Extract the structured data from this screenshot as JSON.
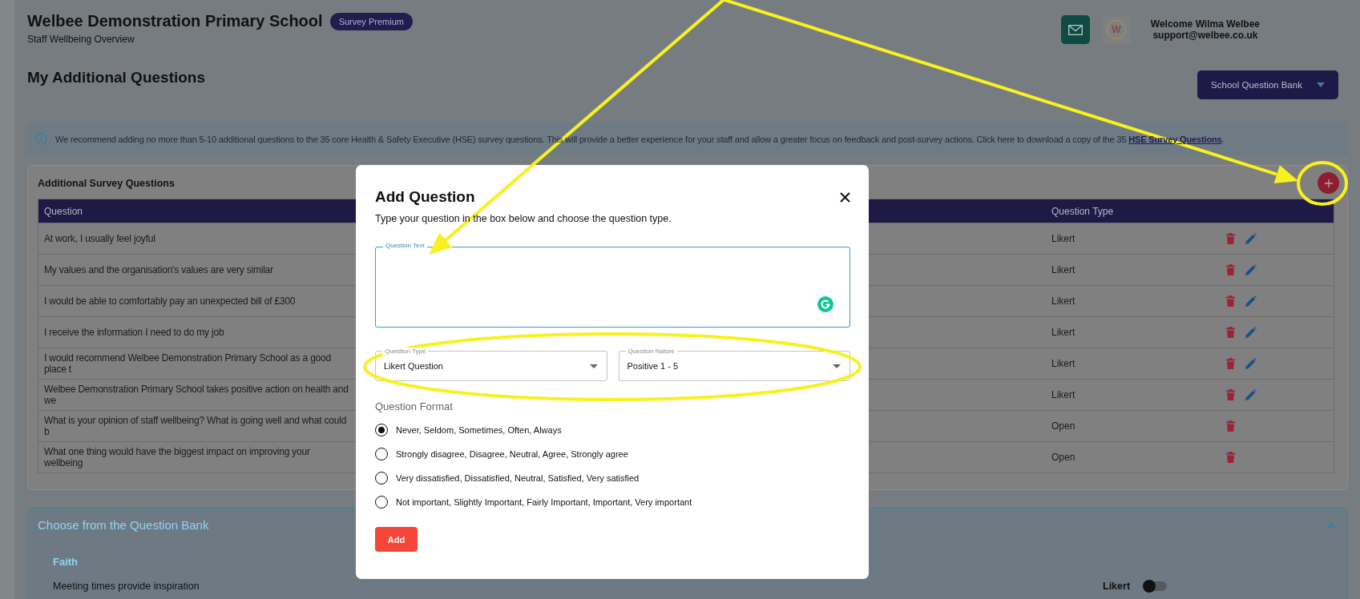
{
  "header": {
    "school": "Welbee Demonstration Primary School",
    "badge": "Survey Premium",
    "subtitle": "Staff Wellbeing Overview",
    "logo_letter": "W",
    "welcome": "Welcome Wilma Welbee",
    "email": "support@welbee.co.uk"
  },
  "page_title": "My Additional Questions",
  "bank_button": {
    "label": "School Question Bank"
  },
  "info": {
    "text": "We recommend adding no more than 5-10 additional questions to the 35 core Health & Safety Executive (HSE) survey questions. This will provide a better experience for your staff and allow a greater focus on feedback and post-survey actions. Click here to download a copy of the 35 ",
    "link": "HSE Survey Questions",
    "end": "."
  },
  "questions_card": {
    "title": "Additional Survey Questions",
    "columns": [
      "Question",
      "Question Type"
    ],
    "rows": [
      {
        "question": "At work, I usually feel joyful",
        "type": "Likert",
        "editable": true
      },
      {
        "question": "My values and the organisation's values are very similar",
        "type": "Likert",
        "editable": true
      },
      {
        "question": "I would be able to comfortably pay an unexpected bill of £300",
        "type": "Likert",
        "editable": true
      },
      {
        "question": "I receive the information I need to do my job",
        "type": "Likert",
        "editable": true
      },
      {
        "question": "I would recommend Welbee Demonstration Primary School as a good place t",
        "type": "Likert",
        "editable": true
      },
      {
        "question": "Welbee Demonstration Primary School takes positive action on health and we",
        "type": "Likert",
        "editable": true
      },
      {
        "question": "What is your opinion of staff wellbeing? What is going well and what could b",
        "type": "Open",
        "editable": false
      },
      {
        "question": "What one thing would have the biggest impact on improving your wellbeing",
        "type": "Open",
        "editable": false
      }
    ]
  },
  "bank_panel": {
    "title": "Choose from the Question Bank",
    "expanded": true,
    "groups": [
      {
        "name": "Faith",
        "items": [
          {
            "text": "Meeting times provide inspiration",
            "type": "Likert",
            "on": false
          }
        ]
      }
    ]
  },
  "modal": {
    "title": "Add Question",
    "subtitle": "Type your question in the box below and choose the question type.",
    "question_text": {
      "label": "Question Text"
    },
    "question_type": {
      "label": "Question Type",
      "value": "Likert Question"
    },
    "question_nature": {
      "label": "Question Nature",
      "value": "Positive 1 - 5"
    },
    "format_label": "Question Format",
    "formats": [
      {
        "label": "Never, Seldom, Sometimes, Often, Always",
        "selected": true
      },
      {
        "label": "Strongly disagree, Disagree, Neutral, Agree, Strongly agree",
        "selected": false
      },
      {
        "label": "Very dissatisfied, Dissatisfied, Neutral, Satisfied, Very satisfied",
        "selected": false
      },
      {
        "label": "Not important, Slightly Important, Fairly Important, Important, Very important",
        "selected": false
      }
    ],
    "add_button": "Add"
  }
}
